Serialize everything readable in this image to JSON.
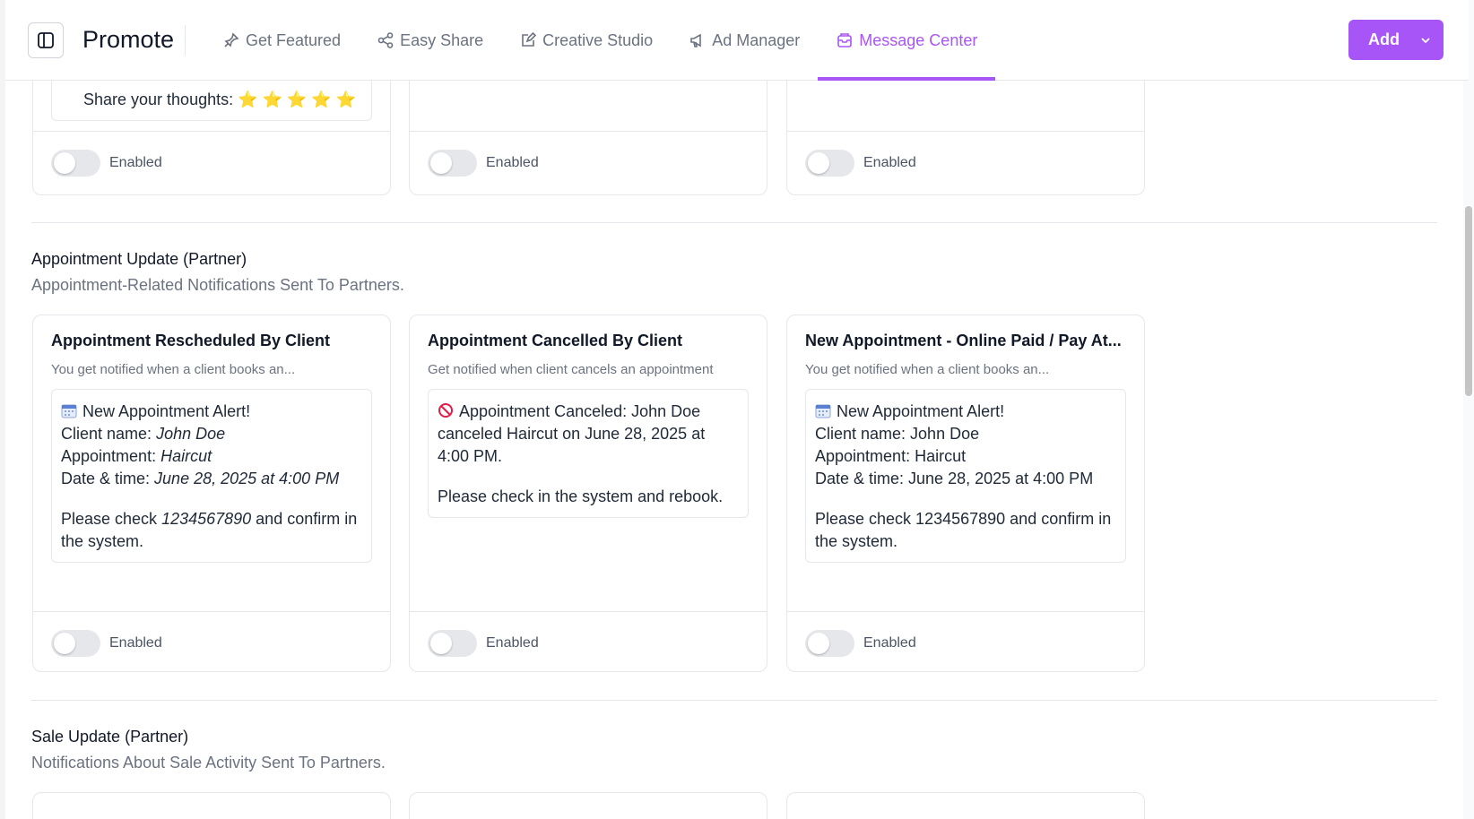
{
  "header": {
    "app_title": "Promote",
    "nav": [
      {
        "label": "Get Featured",
        "icon": "sparkle-pin-icon",
        "active": false
      },
      {
        "label": "Easy Share",
        "icon": "share-nodes-icon",
        "active": false
      },
      {
        "label": "Creative Studio",
        "icon": "edit-square-icon",
        "active": false
      },
      {
        "label": "Ad Manager",
        "icon": "megaphone-icon",
        "active": false
      },
      {
        "label": "Message Center",
        "icon": "inbox-icon",
        "active": true
      }
    ],
    "add_button": "Add"
  },
  "top_row": {
    "partial_preview_text": "Share your thoughts: ⭐ ⭐ ⭐ ⭐ ⭐",
    "toggle_labels": [
      "Enabled",
      "Enabled",
      "Enabled"
    ]
  },
  "section_appointment": {
    "title": "Appointment Update (Partner)",
    "subtitle": "Appointment-Related Notifications Sent To Partners.",
    "cards": [
      {
        "title": "Appointment Rescheduled By Client",
        "description": "You get notified when a client books an...",
        "lines": {
          "l1": "New Appointment Alert!",
          "l2_label": "Client name: ",
          "l2_value": "John Doe",
          "l3_label": "Appointment: ",
          "l3_value": "Haircut",
          "l4_label": "Date & time: ",
          "l4_value": "June 28, 2025 at 4:00 PM",
          "l5_pre": "Please check ",
          "l5_value": "1234567890",
          "l5_post": " and confirm in the system."
        },
        "toggle_label": "Enabled"
      },
      {
        "title": "Appointment Cancelled By Client",
        "description": "Get notified when client cancels an appointment",
        "lines": {
          "l1": "Appointment Canceled: John Doe canceled Haircut on June 28, 2025 at 4:00 PM.",
          "l2": "Please check in the system and rebook."
        },
        "toggle_label": "Enabled"
      },
      {
        "title": "New Appointment - Online Paid / Pay At...",
        "description": "You get notified when a client books an...",
        "lines": {
          "l1": "New Appointment Alert!",
          "l2": "Client name: John Doe",
          "l3": "Appointment: Haircut",
          "l4": "Date & time: June 28, 2025 at 4:00 PM",
          "l5": "Please check 1234567890 and confirm in the system."
        },
        "toggle_label": "Enabled"
      }
    ]
  },
  "section_sale": {
    "title": "Sale Update (Partner)",
    "subtitle": "Notifications About Sale Activity Sent To Partners."
  },
  "colors": {
    "accent": "#a855f7",
    "border": "#e5e7eb",
    "muted_text": "#6b7280"
  }
}
